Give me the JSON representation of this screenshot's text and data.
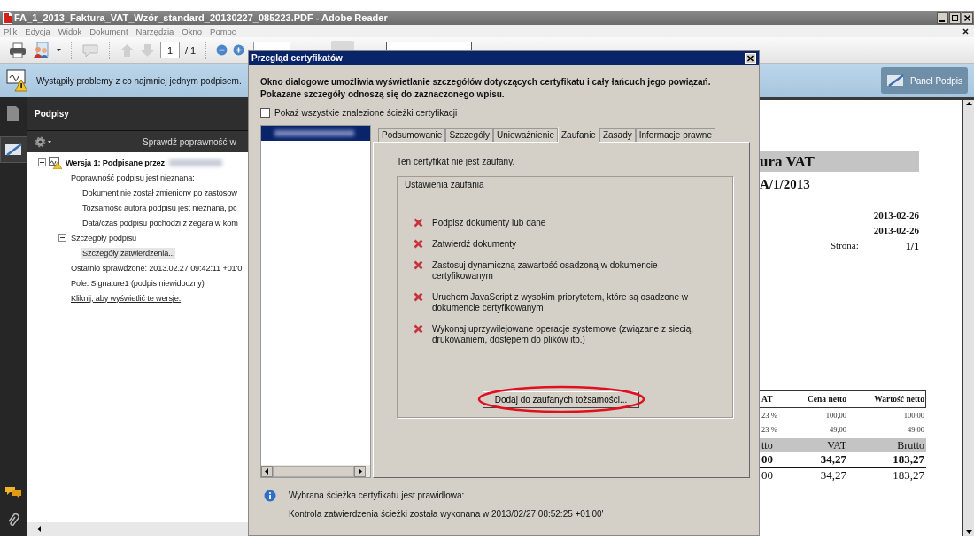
{
  "window": {
    "title": "FA_1_2013_Faktura_VAT_Wzór_standard_20130227_085223.PDF - Adobe Reader"
  },
  "menu": [
    "Plik",
    "Edycja",
    "Widok",
    "Dokument",
    "Narzędzia",
    "Okno",
    "Pomoc"
  ],
  "toolbar": {
    "page": "1",
    "page_total": "/ 1"
  },
  "notice": {
    "text": "Wystąpiły problemy z co najmniej jednym podpisem.",
    "button": "Panel Podpis"
  },
  "signatures_panel": {
    "title": "Podpisy",
    "validate": "Sprawdź poprawność w",
    "tree": [
      {
        "label": "Wersja 1: Podpisane przez",
        "kind": "version",
        "expanded": true,
        "selected": false,
        "children": [
          {
            "label": "Poprawność podpisu jest nieznana:",
            "kind": "text",
            "selected": false,
            "children": [
              {
                "label": "Dokument nie został zmieniony po zastosow",
                "kind": "text",
                "selected": false
              },
              {
                "label": "Tożsamość autora podpisu jest nieznana, pc",
                "kind": "text",
                "selected": false
              },
              {
                "label": "Data/czas podpisu pochodzi z zegara w kom",
                "kind": "text",
                "selected": false
              }
            ]
          },
          {
            "label": "Szczegóły podpisu",
            "kind": "text",
            "expanded": true,
            "selected": false,
            "children": [
              {
                "label": "Szczegóły zatwierdzenia...",
                "kind": "text",
                "selected": true
              }
            ]
          },
          {
            "label": "Ostatnio sprawdzone: 2013.02.27 09:42:11 +01'0",
            "kind": "text",
            "selected": false
          },
          {
            "label": "Pole: Signature1 (podpis niewidoczny)",
            "kind": "text",
            "selected": false
          },
          {
            "label": "Kliknij, aby wyświetlić te wersje.",
            "kind": "link",
            "selected": false
          }
        ]
      }
    ]
  },
  "certificate_dialog": {
    "title": "Przegląd certyfikatów",
    "intro": "Okno dialogowe umożliwia wyświetlanie szczegółów dotyczących certyfikatu i cały łańcuch jego powiązań. Pokazane szczegóły odnoszą się do zaznaczonego wpisu.",
    "show_all_paths": {
      "label": "Pokaż wszystkie znalezione ścieżki certyfikacji",
      "checked": false
    },
    "tabs": [
      {
        "label": "Podsumowanie",
        "selected": false
      },
      {
        "label": "Szczegóły",
        "selected": false
      },
      {
        "label": "Unieważnienie",
        "selected": false
      },
      {
        "label": "Zaufanie",
        "selected": true
      },
      {
        "label": "Zasady",
        "selected": false
      },
      {
        "label": "Informacje prawne",
        "selected": false
      }
    ],
    "trust_status": "Ten certyfikat nie jest zaufany.",
    "trust_settings": {
      "title": "Ustawienia zaufania",
      "items": [
        {
          "label": "Podpisz dokumenty lub dane",
          "allowed": false
        },
        {
          "label": "Zatwierdź dokumenty",
          "allowed": false
        },
        {
          "label": "Zastosuj dynamiczną zawartość osadzoną w dokumencie certyfikowanym",
          "allowed": false
        },
        {
          "label": "Uruchom JavaScript z wysokim priorytetem, które są osadzone w dokumencie certyfikowanym",
          "allowed": false
        },
        {
          "label": "Wykonaj uprzywilejowane operacje systemowe (związane z siecią, drukowaniem, dostępem do plików itp.)",
          "allowed": false
        }
      ]
    },
    "add_button": "Dodaj do zaufanych tożsamości...",
    "validity": "Wybrana ścieżka certyfikatu jest prawidłowa:",
    "validation_time": "Kontrola zatwierdzenia ścieżki została wykonana w 2013/02/27 08:52:25 +01'00'"
  },
  "document": {
    "title": "ura VAT",
    "number": "A/1/2013",
    "dates": [
      "2013-02-26",
      "2013-02-26"
    ],
    "page_label": "Strona:",
    "page_value": "1/1",
    "table": {
      "columns": [
        "AT",
        "Cena netto",
        "Wartość netto"
      ],
      "rows": [
        [
          "23 %",
          "100,00",
          "100,00"
        ],
        [
          "23 %",
          "49,00",
          "49,00"
        ]
      ]
    },
    "summary": {
      "columns": [
        "tto",
        "VAT",
        "Brutto"
      ],
      "rows": [
        {
          "cells": [
            "00",
            "34,27",
            "183,27"
          ],
          "bold": true
        },
        {
          "cells": [
            "00",
            "34,27",
            "183,27"
          ],
          "bold": false
        }
      ]
    }
  }
}
